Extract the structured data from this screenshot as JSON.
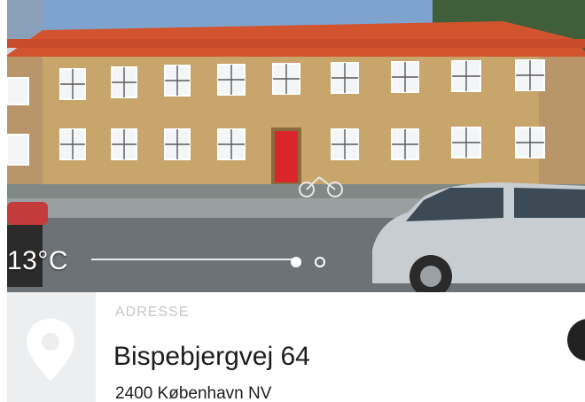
{
  "weather": {
    "temperature": "13°C"
  },
  "carousel": {
    "active_index": 0,
    "count": 2
  },
  "address": {
    "label": "ADRESSE",
    "street": "Bispebjergvej 64",
    "city": "2400 København NV"
  },
  "icons": {
    "map": "map-pin-icon"
  },
  "colors": {
    "roof": "#d2542f",
    "door": "#d8262a",
    "wall": "#c7a56b"
  }
}
